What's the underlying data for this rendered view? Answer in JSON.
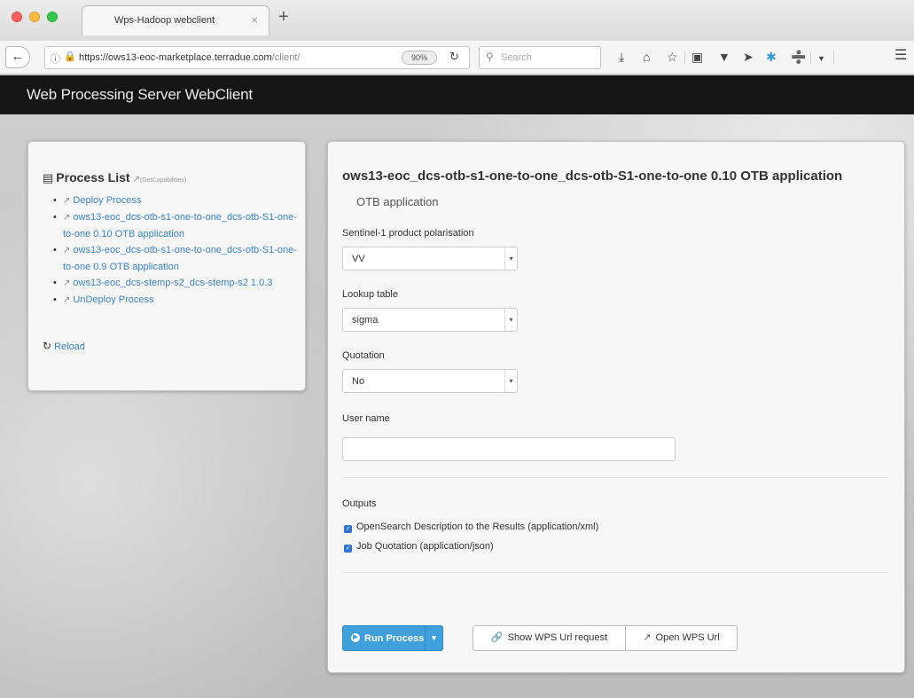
{
  "browser": {
    "tab_title": "Wps-Hadoop webclient",
    "tab_close": "×",
    "new_tab": "+",
    "url_main": "https://ows13-eoc-marketplace.terradue.com",
    "url_path": "/client/",
    "zoom": "90%",
    "search_placeholder": "Search",
    "icons": {
      "back": "arrow-left-icon",
      "info": "info-icon",
      "lock": "lock-icon",
      "reload": "reload-icon",
      "search": "search-icon",
      "download": "download-icon",
      "home": "home-icon",
      "bookmark": "star-icon",
      "library": "clipboard-icon",
      "pocket": "pocket-icon",
      "send": "send-icon",
      "extension": "extension-icon",
      "extension2": "extension-alt-icon",
      "overflow": "chevron-down-icon",
      "menu": "hamburger-menu-icon"
    }
  },
  "app": {
    "title": "Web Processing Server WebClient"
  },
  "process_list": {
    "title": "Process List",
    "getcap": "(GetCapabilities)",
    "items": [
      "Deploy Process",
      "ows13-eoc_dcs-otb-s1-one-to-one_dcs-otb-S1-one-to-one 0.10 OTB application",
      "ows13-eoc_dcs-otb-s1-one-to-one_dcs-otb-S1-one-to-one 0.9 OTB application",
      "ows13-eoc_dcs-stemp-s2_dcs-stemp-s2 1.0.3",
      "UnDeploy Process"
    ],
    "reload": "Reload"
  },
  "process": {
    "title": "ows13-eoc_dcs-otb-s1-one-to-one_dcs-otb-S1-one-to-one 0.10 OTB application",
    "subtitle": "OTB application",
    "fields": {
      "polarisation": {
        "label": "Sentinel-1 product polarisation",
        "value": "VV"
      },
      "lookup": {
        "label": "Lookup table",
        "value": "sigma"
      },
      "quotation": {
        "label": "Quotation",
        "value": "No"
      },
      "username": {
        "label": "User name",
        "value": ""
      }
    },
    "outputs_label": "Outputs",
    "outputs": [
      {
        "label": "OpenSearch Description to the Results (application/xml)",
        "checked": true
      },
      {
        "label": "Job Quotation (application/json)",
        "checked": true
      }
    ],
    "buttons": {
      "run": "Run Process",
      "show_url": "Show WPS Url request",
      "open_url": "Open WPS Url"
    }
  },
  "colors": {
    "header_bg": "#151515",
    "link": "#3a84c4",
    "primary_button": "#3fa0dc",
    "checkbox": "#2f74d6"
  }
}
